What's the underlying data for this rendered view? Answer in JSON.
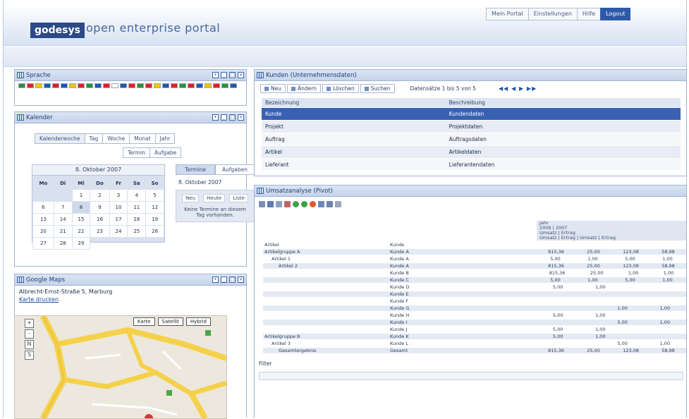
{
  "header": {
    "logo": "godesys",
    "tagline": "open enterprise portal",
    "nav": [
      {
        "label": "Mein Portal"
      },
      {
        "label": "Einstellungen"
      },
      {
        "label": "Hilfe"
      },
      {
        "label": "Logout",
        "active": true
      }
    ]
  },
  "languages": {
    "title": "Sprache",
    "flag_colors": [
      "#2b8f3d",
      "#d22",
      "#f2c40f",
      "#1f56b0",
      "#d22",
      "#1f56b0",
      "#f2c40f",
      "#d22",
      "#2b8f3d",
      "#1f56b0",
      "#d22",
      "#fff",
      "#1f56b0",
      "#d22",
      "#2b8f3d",
      "#d22",
      "#f2c40f",
      "#1f56b0",
      "#d22",
      "#2b8f3d",
      "#d22",
      "#1f56b0",
      "#f2c40f",
      "#d22",
      "#2b8f3d",
      "#1f56b0"
    ]
  },
  "calendar": {
    "title": "Kalender",
    "tabs_top": [
      "Kalenderwoche",
      "Tag",
      "Woche",
      "Monat",
      "Jahr"
    ],
    "tabs_bottom": [
      "Termin",
      "Aufgabe"
    ],
    "month_title": "8. Oktober 2007",
    "weekdays": [
      "Mo",
      "Di",
      "Mi",
      "Do",
      "Fr",
      "Sa",
      "So"
    ],
    "weeks": [
      [
        "",
        "",
        "1",
        "2",
        "3",
        "4",
        "5"
      ],
      [
        "6",
        "7",
        "8",
        "9",
        "10",
        "11",
        "12"
      ],
      [
        "13",
        "14",
        "15",
        "16",
        "17",
        "18",
        "19"
      ],
      [
        "20",
        "21",
        "22",
        "23",
        "24",
        "25",
        "26"
      ],
      [
        "27",
        "28",
        "29",
        "",
        "",
        "",
        ""
      ]
    ],
    "side_tabs": [
      "Termine",
      "Aufgaben"
    ],
    "side_date": "8. Oktober 2007",
    "side_row": [
      "Neu",
      "Heute",
      "Liste"
    ],
    "side_text": "Keine Termine an diesem Tag vorhanden."
  },
  "map": {
    "title": "Google Maps",
    "address": "Albrecht-Ernst-Straße 5, Marburg",
    "link": "Karte drucken",
    "types": [
      "Karte",
      "Satellit",
      "Hybrid"
    ],
    "controls": [
      "+",
      "-",
      "N",
      "S"
    ]
  },
  "grid_portlet": {
    "title": "Kunden (Unternehmensdaten)",
    "buttons": [
      "Neu",
      "Ändern",
      "Löschen",
      "Suchen"
    ],
    "records": "Datensätze 1 bis 5 von 5",
    "pager": "◀◀ ◀ ▶ ▶▶",
    "columns": [
      "Bezeichnung",
      "Beschreibung"
    ],
    "rows": [
      [
        "Kunde",
        "Kundendaten"
      ],
      [
        "Projekt",
        "Projektdaten"
      ],
      [
        "Auftrag",
        "Auftragsdaten"
      ],
      [
        "Artikel",
        "Artikeldaten"
      ],
      [
        "Lieferant",
        "Lieferantendaten"
      ]
    ],
    "selected_row": 0
  },
  "pivot_portlet": {
    "title": "Umsatzanalyse (Pivot)",
    "header_lines": [
      "Jahr",
      "2006 | 2007",
      "Umsatz | Ertrag",
      "Umsatz | Ertrag | Umsatz | Ertrag"
    ],
    "col_a": "Artikel",
    "col_b": "Kunde",
    "rows": [
      {
        "a": "Artikelgruppe A",
        "b": "Kunde A",
        "v": [
          "815,36",
          "25,00",
          "123,08",
          "58,98"
        ]
      },
      {
        "a": "Artikel 1",
        "b": "Kunde A",
        "v": [
          "5,00",
          "1,00",
          "5,00",
          "1,00"
        ]
      },
      {
        "a": "Artikel 2",
        "b": "Kunde A",
        "v": [
          "815,36",
          "25,00",
          "123,08",
          "58,98"
        ]
      },
      {
        "a": "",
        "b": "Kunde B",
        "v": [
          "815,36",
          "25,00",
          "1,00",
          "1,00"
        ]
      },
      {
        "a": "",
        "b": "Kunde C",
        "v": [
          "5,00",
          "1,00",
          "5,00",
          "1,00"
        ]
      },
      {
        "a": "",
        "b": "Kunde D",
        "v": [
          "5,00",
          "1,00",
          "",
          ""
        ]
      },
      {
        "a": "",
        "b": "Kunde E",
        "v": [
          "",
          "",
          "",
          ""
        ]
      },
      {
        "a": "",
        "b": "Kunde F",
        "v": [
          "",
          "",
          "",
          ""
        ]
      },
      {
        "a": "",
        "b": "Kunde G",
        "v": [
          "",
          "",
          "1,00",
          "1,00"
        ]
      },
      {
        "a": "",
        "b": "Kunde H",
        "v": [
          "5,00",
          "1,00",
          "",
          ""
        ]
      },
      {
        "a": "",
        "b": "Kunde I",
        "v": [
          "",
          "",
          "5,00",
          "1,00"
        ]
      },
      {
        "a": "",
        "b": "Kunde J",
        "v": [
          "5,00",
          "1,00",
          "",
          ""
        ]
      },
      {
        "a": "Artikelgruppe B",
        "b": "Kunde K",
        "v": [
          "5,00",
          "1,00",
          "",
          ""
        ]
      },
      {
        "a": "Artikel 3",
        "b": "Kunde L",
        "v": [
          "",
          "",
          "5,00",
          "1,00"
        ]
      },
      {
        "a": "Gesamtergebnis",
        "b": "Gesamt",
        "v": [
          "815,36",
          "25,00",
          "123,08",
          "58,98"
        ]
      }
    ],
    "filter_label": "Filter"
  }
}
